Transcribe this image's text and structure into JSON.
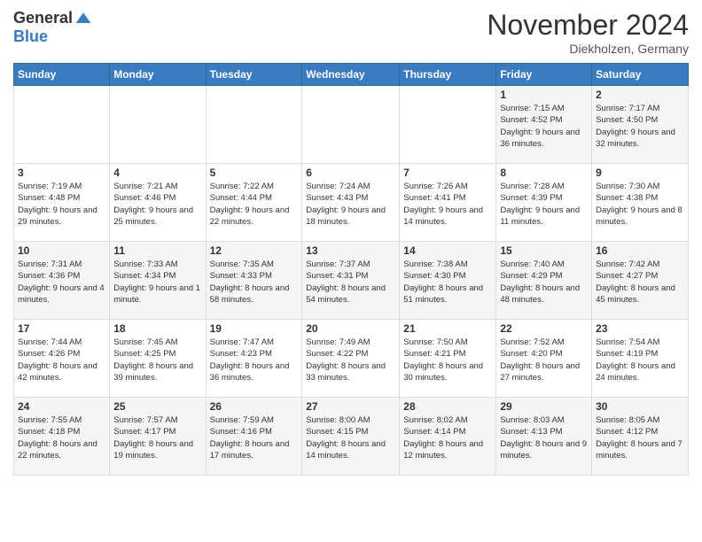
{
  "logo": {
    "general": "General",
    "blue": "Blue"
  },
  "title": "November 2024",
  "location": "Diekholzen, Germany",
  "headers": [
    "Sunday",
    "Monday",
    "Tuesday",
    "Wednesday",
    "Thursday",
    "Friday",
    "Saturday"
  ],
  "weeks": [
    [
      {
        "day": "",
        "sunrise": "",
        "sunset": "",
        "daylight": ""
      },
      {
        "day": "",
        "sunrise": "",
        "sunset": "",
        "daylight": ""
      },
      {
        "day": "",
        "sunrise": "",
        "sunset": "",
        "daylight": ""
      },
      {
        "day": "",
        "sunrise": "",
        "sunset": "",
        "daylight": ""
      },
      {
        "day": "",
        "sunrise": "",
        "sunset": "",
        "daylight": ""
      },
      {
        "day": "1",
        "sunrise": "Sunrise: 7:15 AM",
        "sunset": "Sunset: 4:52 PM",
        "daylight": "Daylight: 9 hours and 36 minutes."
      },
      {
        "day": "2",
        "sunrise": "Sunrise: 7:17 AM",
        "sunset": "Sunset: 4:50 PM",
        "daylight": "Daylight: 9 hours and 32 minutes."
      }
    ],
    [
      {
        "day": "3",
        "sunrise": "Sunrise: 7:19 AM",
        "sunset": "Sunset: 4:48 PM",
        "daylight": "Daylight: 9 hours and 29 minutes."
      },
      {
        "day": "4",
        "sunrise": "Sunrise: 7:21 AM",
        "sunset": "Sunset: 4:46 PM",
        "daylight": "Daylight: 9 hours and 25 minutes."
      },
      {
        "day": "5",
        "sunrise": "Sunrise: 7:22 AM",
        "sunset": "Sunset: 4:44 PM",
        "daylight": "Daylight: 9 hours and 22 minutes."
      },
      {
        "day": "6",
        "sunrise": "Sunrise: 7:24 AM",
        "sunset": "Sunset: 4:43 PM",
        "daylight": "Daylight: 9 hours and 18 minutes."
      },
      {
        "day": "7",
        "sunrise": "Sunrise: 7:26 AM",
        "sunset": "Sunset: 4:41 PM",
        "daylight": "Daylight: 9 hours and 14 minutes."
      },
      {
        "day": "8",
        "sunrise": "Sunrise: 7:28 AM",
        "sunset": "Sunset: 4:39 PM",
        "daylight": "Daylight: 9 hours and 11 minutes."
      },
      {
        "day": "9",
        "sunrise": "Sunrise: 7:30 AM",
        "sunset": "Sunset: 4:38 PM",
        "daylight": "Daylight: 9 hours and 8 minutes."
      }
    ],
    [
      {
        "day": "10",
        "sunrise": "Sunrise: 7:31 AM",
        "sunset": "Sunset: 4:36 PM",
        "daylight": "Daylight: 9 hours and 4 minutes."
      },
      {
        "day": "11",
        "sunrise": "Sunrise: 7:33 AM",
        "sunset": "Sunset: 4:34 PM",
        "daylight": "Daylight: 9 hours and 1 minute."
      },
      {
        "day": "12",
        "sunrise": "Sunrise: 7:35 AM",
        "sunset": "Sunset: 4:33 PM",
        "daylight": "Daylight: 8 hours and 58 minutes."
      },
      {
        "day": "13",
        "sunrise": "Sunrise: 7:37 AM",
        "sunset": "Sunset: 4:31 PM",
        "daylight": "Daylight: 8 hours and 54 minutes."
      },
      {
        "day": "14",
        "sunrise": "Sunrise: 7:38 AM",
        "sunset": "Sunset: 4:30 PM",
        "daylight": "Daylight: 8 hours and 51 minutes."
      },
      {
        "day": "15",
        "sunrise": "Sunrise: 7:40 AM",
        "sunset": "Sunset: 4:29 PM",
        "daylight": "Daylight: 8 hours and 48 minutes."
      },
      {
        "day": "16",
        "sunrise": "Sunrise: 7:42 AM",
        "sunset": "Sunset: 4:27 PM",
        "daylight": "Daylight: 8 hours and 45 minutes."
      }
    ],
    [
      {
        "day": "17",
        "sunrise": "Sunrise: 7:44 AM",
        "sunset": "Sunset: 4:26 PM",
        "daylight": "Daylight: 8 hours and 42 minutes."
      },
      {
        "day": "18",
        "sunrise": "Sunrise: 7:45 AM",
        "sunset": "Sunset: 4:25 PM",
        "daylight": "Daylight: 8 hours and 39 minutes."
      },
      {
        "day": "19",
        "sunrise": "Sunrise: 7:47 AM",
        "sunset": "Sunset: 4:23 PM",
        "daylight": "Daylight: 8 hours and 36 minutes."
      },
      {
        "day": "20",
        "sunrise": "Sunrise: 7:49 AM",
        "sunset": "Sunset: 4:22 PM",
        "daylight": "Daylight: 8 hours and 33 minutes."
      },
      {
        "day": "21",
        "sunrise": "Sunrise: 7:50 AM",
        "sunset": "Sunset: 4:21 PM",
        "daylight": "Daylight: 8 hours and 30 minutes."
      },
      {
        "day": "22",
        "sunrise": "Sunrise: 7:52 AM",
        "sunset": "Sunset: 4:20 PM",
        "daylight": "Daylight: 8 hours and 27 minutes."
      },
      {
        "day": "23",
        "sunrise": "Sunrise: 7:54 AM",
        "sunset": "Sunset: 4:19 PM",
        "daylight": "Daylight: 8 hours and 24 minutes."
      }
    ],
    [
      {
        "day": "24",
        "sunrise": "Sunrise: 7:55 AM",
        "sunset": "Sunset: 4:18 PM",
        "daylight": "Daylight: 8 hours and 22 minutes."
      },
      {
        "day": "25",
        "sunrise": "Sunrise: 7:57 AM",
        "sunset": "Sunset: 4:17 PM",
        "daylight": "Daylight: 8 hours and 19 minutes."
      },
      {
        "day": "26",
        "sunrise": "Sunrise: 7:59 AM",
        "sunset": "Sunset: 4:16 PM",
        "daylight": "Daylight: 8 hours and 17 minutes."
      },
      {
        "day": "27",
        "sunrise": "Sunrise: 8:00 AM",
        "sunset": "Sunset: 4:15 PM",
        "daylight": "Daylight: 8 hours and 14 minutes."
      },
      {
        "day": "28",
        "sunrise": "Sunrise: 8:02 AM",
        "sunset": "Sunset: 4:14 PM",
        "daylight": "Daylight: 8 hours and 12 minutes."
      },
      {
        "day": "29",
        "sunrise": "Sunrise: 8:03 AM",
        "sunset": "Sunset: 4:13 PM",
        "daylight": "Daylight: 8 hours and 9 minutes."
      },
      {
        "day": "30",
        "sunrise": "Sunrise: 8:05 AM",
        "sunset": "Sunset: 4:12 PM",
        "daylight": "Daylight: 8 hours and 7 minutes."
      }
    ]
  ]
}
